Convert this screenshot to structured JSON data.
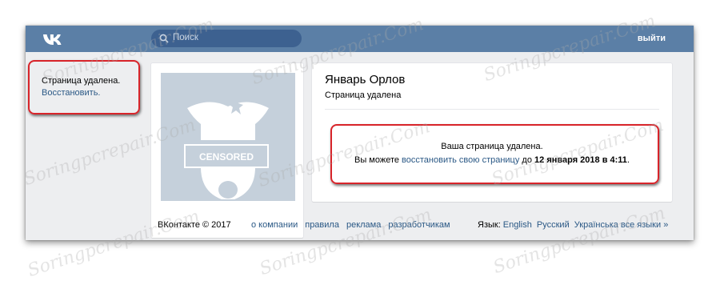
{
  "header": {
    "search_placeholder": "Поиск",
    "logout_label": "выйти"
  },
  "sidebar": {
    "deleted_note": "Страница удалена.",
    "restore_link": "Восстановить."
  },
  "profile": {
    "name": "Январь Орлов",
    "status": "Страница удалена",
    "avatar_stamp": "CENSORED",
    "message_title": "Ваша страница удалена.",
    "message_prefix": "Вы можете ",
    "message_link": "восстановить свою страницу",
    "message_middle": " до ",
    "message_deadline": "12 января 2018 в 4:11",
    "message_suffix": "."
  },
  "footer": {
    "copyright": "ВКонтакте © 2017",
    "nav": [
      "о компании",
      "правила",
      "реклама",
      "разработчикам"
    ],
    "language_label": "Язык:",
    "languages": [
      "English",
      "Русский",
      "Українська",
      "все языки »"
    ]
  },
  "watermark": "Soringpcrepair.Com",
  "colors": {
    "topbar": "#5b7fa6",
    "search_bg": "#3d6190",
    "link": "#2a5885",
    "page_bg": "#edeef0",
    "highlight": "#d8242a",
    "avatar_bg": "#c5d0db"
  }
}
